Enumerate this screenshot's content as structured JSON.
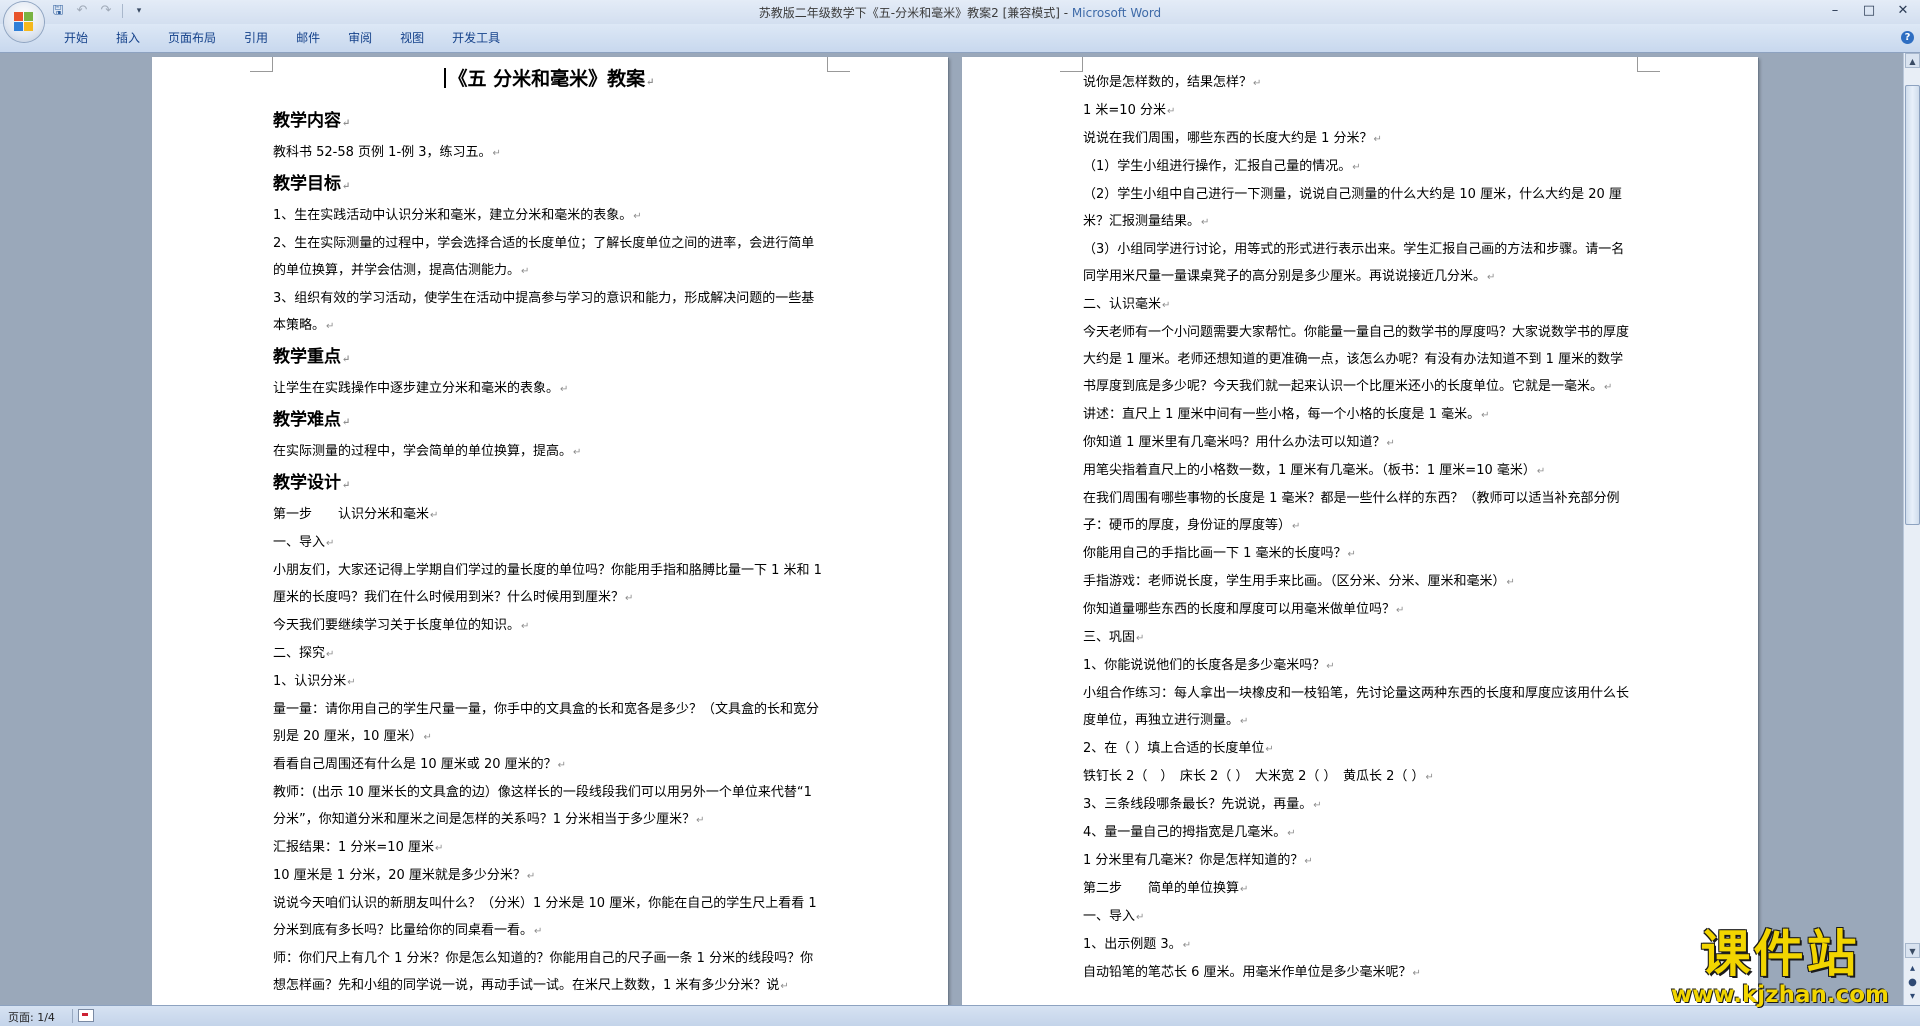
{
  "window": {
    "title_doc": "苏教版二年级数学下《五-分米和毫米》教案2 [兼容模式] - ",
    "title_app": "Microsoft Word"
  },
  "ribbon": {
    "tabs": [
      "开始",
      "插入",
      "页面布局",
      "引用",
      "邮件",
      "审阅",
      "视图",
      "开发工具"
    ]
  },
  "status": {
    "page": "页面: 1/4"
  },
  "watermark": {
    "main": "课件站",
    "url": "www.kjzhan.com"
  },
  "pages": {
    "left": [
      {
        "t": "title",
        "text": "《五 分米和毫米》教案"
      },
      {
        "t": "h",
        "text": "教学内容"
      },
      {
        "t": "p",
        "text": "教科书 52-58 页例 1-例 3，练习五。"
      },
      {
        "t": "h",
        "text": "教学目标"
      },
      {
        "t": "p",
        "text": "1、生在实践活动中认识分米和毫米，建立分米和毫米的表象。"
      },
      {
        "t": "p",
        "text": "2、生在实际测量的过程中，学会选择合适的长度单位；了解长度单位之间的进率，会进行简单的单位换算，并学会估测，提高估测能力。"
      },
      {
        "t": "p",
        "text": "3、组织有效的学习活动，使学生在活动中提高参与学习的意识和能力，形成解决问题的一些基本策略。"
      },
      {
        "t": "h",
        "text": "教学重点"
      },
      {
        "t": "p",
        "text": "让学生在实践操作中逐步建立分米和毫米的表象。"
      },
      {
        "t": "h",
        "text": "教学难点"
      },
      {
        "t": "p",
        "text": "在实际测量的过程中，学会简单的单位换算，提高。"
      },
      {
        "t": "h",
        "text": "教学设计"
      },
      {
        "t": "p",
        "text": "第一步　　认识分米和毫米"
      },
      {
        "t": "p",
        "text": "一、导入"
      },
      {
        "t": "p",
        "text": "小朋友们，大家还记得上学期自们学过的量长度的单位吗？你能用手指和胳膊比量一下 1 米和 1 厘米的长度吗？我们在什么时候用到米？什么时候用到厘米？"
      },
      {
        "t": "p",
        "text": "今天我们要继续学习关于长度单位的知识。"
      },
      {
        "t": "p",
        "text": "二、探究"
      },
      {
        "t": "p",
        "text": "1、认识分米"
      },
      {
        "t": "p",
        "text": "量一量：请你用自己的学生尺量一量，你手中的文具盒的长和宽各是多少？（文具盒的长和宽分别是 20 厘米，10 厘米）"
      },
      {
        "t": "p",
        "text": "看看自己周围还有什么是 10 厘米或 20 厘米的？"
      },
      {
        "t": "p",
        "text": "教师：(出示 10 厘米长的文具盒的边）像这样长的一段线段我们可以用另外一个单位来代替“1 分米”，你知道分米和厘米之间是怎样的关系吗？1 分米相当于多少厘米？"
      },
      {
        "t": "p",
        "text": "汇报结果：1 分米=10 厘米"
      },
      {
        "t": "p",
        "text": "10 厘米是 1 分米，20 厘米就是多少分米？"
      },
      {
        "t": "p",
        "text": "说说今天咱们认识的新朋友叫什么？（分米）1 分米是 10 厘米，你能在自己的学生尺上看看 1 分米到底有多长吗？比量给你的同桌看一看。"
      },
      {
        "t": "p",
        "text": "师：你们尺上有几个 1 分米？你是怎么知道的？你能用自己的尺子画一条 1 分米的线段吗？你想怎样画？先和小组的同学说一说，再动手试一试。在米尺上数数，1 米有多少分米？说"
      }
    ],
    "right": [
      {
        "t": "p",
        "text": "说你是怎样数的，结果怎样？"
      },
      {
        "t": "p",
        "text": "1 米=10 分米"
      },
      {
        "t": "p",
        "text": "说说在我们周围，哪些东西的长度大约是 1 分米？"
      },
      {
        "t": "p",
        "text": "（1）学生小组进行操作，汇报自己量的情况。"
      },
      {
        "t": "p",
        "text": "（2）学生小组中自己进行一下测量，说说自己测量的什么大约是 10 厘米，什么大约是 20 厘米？汇报测量结果。"
      },
      {
        "t": "p",
        "text": "（3）小组同学进行讨论，用等式的形式进行表示出来。学生汇报自己画的方法和步骤。请一名同学用米尺量一量课桌凳子的高分别是多少厘米。再说说接近几分米。"
      },
      {
        "t": "p",
        "text": "二、认识毫米"
      },
      {
        "t": "p",
        "text": "今天老师有一个小问题需要大家帮忙。你能量一量自己的数学书的厚度吗？大家说数学书的厚度大约是 1 厘米。老师还想知道的更准确一点，该怎么办呢？有没有办法知道不到 1 厘米的数学书厚度到底是多少呢？今天我们就一起来认识一个比厘米还小的长度单位。它就是一毫米。"
      },
      {
        "t": "p",
        "text": "讲述：直尺上 1 厘米中间有一些小格，每一个小格的长度是 1 毫米。"
      },
      {
        "t": "p",
        "text": "你知道 1 厘米里有几毫米吗？用什么办法可以知道？"
      },
      {
        "t": "p",
        "text": "用笔尖指着直尺上的小格数一数，1 厘米有几毫米。（板书：1 厘米=10 毫米）"
      },
      {
        "t": "p",
        "text": "在我们周围有哪些事物的长度是 1 毫米？都是一些什么样的东西？（教师可以适当补充部分例子：硬币的厚度，身份证的厚度等）"
      },
      {
        "t": "p",
        "text": "你能用自己的手指比画一下 1 毫米的长度吗？"
      },
      {
        "t": "p",
        "text": "手指游戏：老师说长度，学生用手来比画。（区分米、分米、厘米和毫米）"
      },
      {
        "t": "p",
        "text": "你知道量哪些东西的长度和厚度可以用毫米做单位吗？"
      },
      {
        "t": "p",
        "text": "三、巩固"
      },
      {
        "t": "p",
        "text": "1、你能说说他们的长度各是多少毫米吗？"
      },
      {
        "t": "p",
        "text": "小组合作练习：每人拿出一块橡皮和一枝铅笔，先讨论量这两种东西的长度和厚度应该用什么长度单位，再独立进行测量。"
      },
      {
        "t": "p",
        "text": "2、在（ ）填上合适的长度单位"
      },
      {
        "t": "p",
        "text": "铁钉长 2（　）　床长 2（ ）　大米宽 2（ ）　黄瓜长 2（ ）"
      },
      {
        "t": "p",
        "text": "3、三条线段哪条最长？先说说，再量。"
      },
      {
        "t": "p",
        "text": "4、量一量自己的拇指宽是几毫米。"
      },
      {
        "t": "p",
        "text": "1 分米里有几毫米？你是怎样知道的？"
      },
      {
        "t": "p",
        "text": "第二步　　简单的单位换算"
      },
      {
        "t": "p",
        "text": "一、导入"
      },
      {
        "t": "p",
        "text": "1、出示例题 3。"
      },
      {
        "t": "p",
        "text": "自动铅笔的笔芯长 6 厘米。用毫米作单位是多少毫米呢？"
      }
    ]
  }
}
